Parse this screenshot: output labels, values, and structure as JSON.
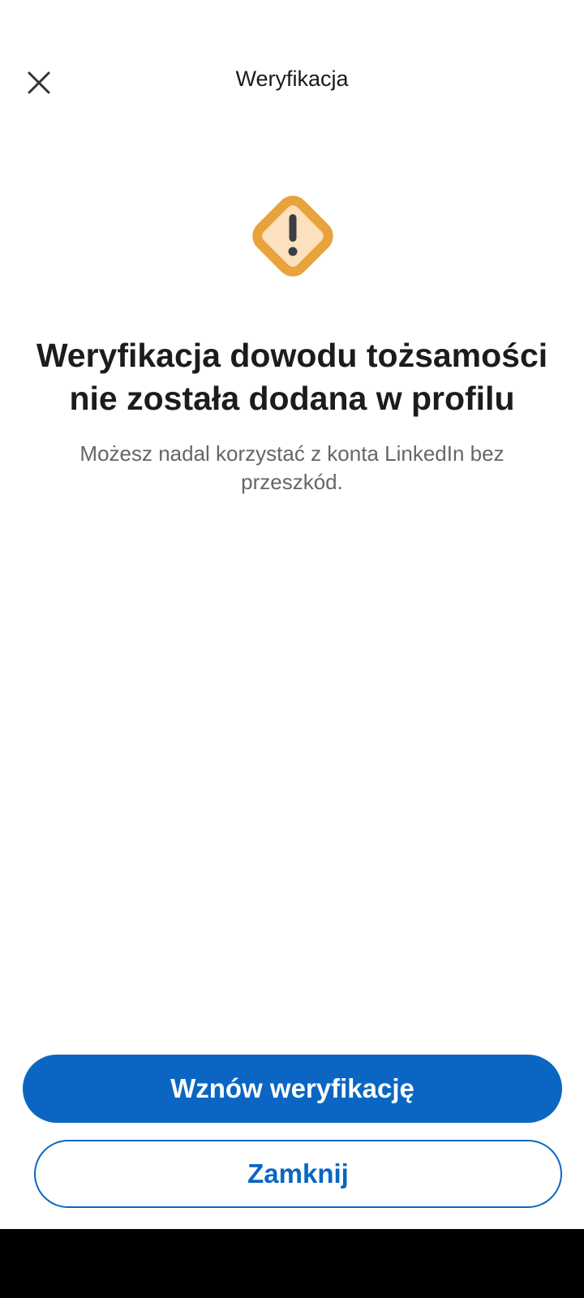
{
  "header": {
    "title": "Weryfikacja",
    "close_icon": "close-icon"
  },
  "status": {
    "icon": "warning-icon",
    "headline": "Weryfikacja dowodu tożsamości nie została dodana w profilu",
    "description": "Możesz nadal korzystać z konta LinkedIn bez przeszkód."
  },
  "actions": {
    "primary_label": "Wznów weryfikację",
    "secondary_label": "Zamknij"
  },
  "colors": {
    "accent": "#0a66c2",
    "warning": "#e8a33d",
    "warning_fill": "#fde0bd"
  }
}
